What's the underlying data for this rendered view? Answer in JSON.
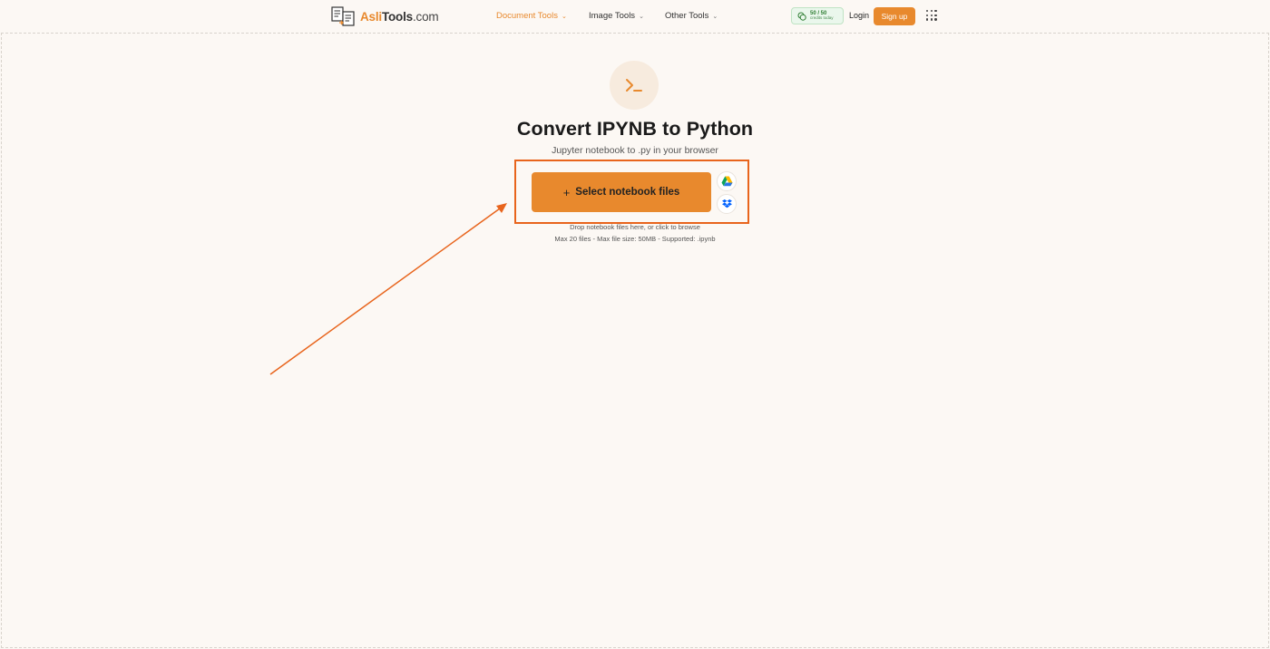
{
  "header": {
    "logo": {
      "brand": "Asli",
      "rest": "Tools",
      "tld": ".com"
    },
    "nav": [
      {
        "label": "Document Tools",
        "active": true
      },
      {
        "label": "Image Tools",
        "active": false
      },
      {
        "label": "Other Tools",
        "active": false
      }
    ],
    "credits": {
      "main": "50 / 50",
      "sub": "credits today"
    },
    "login_label": "Login",
    "signup_label": "Sign up"
  },
  "main": {
    "icon": "terminal-icon",
    "title": "Convert IPYNB to Python",
    "subtitle": "Jupyter notebook to .py in your browser",
    "select_button": {
      "plus": "+",
      "label": "Select notebook files"
    },
    "cloud_sources": [
      "google-drive-icon",
      "dropbox-icon"
    ],
    "drop_hint": "Drop notebook files here, or click to browse",
    "limits": "Max 20 files - Max file size: 50MB - Supported: .ipynb"
  },
  "colors": {
    "accent": "#e8892d",
    "highlight": "#e8641c",
    "background": "#fcf8f4"
  }
}
